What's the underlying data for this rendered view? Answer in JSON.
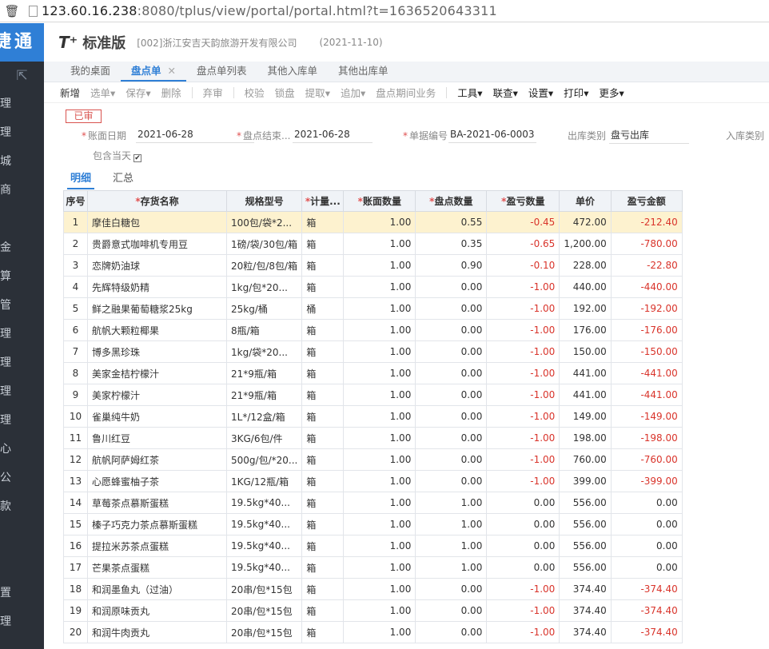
{
  "browser": {
    "url_host": "123.60.16.238",
    "url_rest": ":8080/tplus/view/portal/portal.html?t=1636520643311"
  },
  "sidebar": {
    "brand": "捷通",
    "items": [
      "理",
      "理",
      "城",
      "商",
      "金",
      "算",
      "管",
      "理",
      "理",
      "理",
      "理",
      "心",
      "公",
      "款",
      "置",
      "理"
    ]
  },
  "header": {
    "logo": "T⁺",
    "product": "标准版",
    "company": "[002]浙江安吉天韵旅游开发有限公司",
    "date": "(2021-11-10)"
  },
  "tabs": [
    {
      "label": "我的桌面",
      "active": false
    },
    {
      "label": "盘点单",
      "active": true,
      "close": "✕"
    },
    {
      "label": "盘点单列表",
      "active": false
    },
    {
      "label": "其他入库单",
      "active": false
    },
    {
      "label": "其他出库单",
      "active": false
    }
  ],
  "toolbar": {
    "new": "新增",
    "select": "选单",
    "save": "保存",
    "delete": "删除",
    "abandon": "弃审",
    "verify": "校验",
    "lock": "锁盘",
    "extract": "提取",
    "append": "追加",
    "period_business": "盘点期间业务",
    "tools": "工具",
    "link": "联查",
    "settings": "设置",
    "print": "打印",
    "more": "更多"
  },
  "form": {
    "status_stamp": "已审",
    "account_date_label": "账面日期",
    "account_date_value": "2021-06-28",
    "count_end_label": "盘点结束...",
    "count_end_value": "2021-06-28",
    "doc_no_label": "单据编号",
    "doc_no_value": "BA-2021-06-0003",
    "out_type_label": "出库类别",
    "out_type_value": "盘亏出库",
    "in_type_label": "入库类别",
    "include_today_label": "包含当天",
    "subtab_detail": "明细",
    "subtab_summary": "汇总"
  },
  "grid": {
    "headers": [
      "序号",
      "存货名称",
      "规格型号",
      "计量...",
      "账面数量",
      "盘点数量",
      "盈亏数量",
      "单价",
      "盈亏金额"
    ],
    "rows": [
      [
        "1",
        "摩佳白糖包",
        "100包/袋*2...",
        "箱",
        "1.00",
        "0.55",
        "-0.45",
        "472.00",
        "-212.40"
      ],
      [
        "2",
        "贵爵意式咖啡机专用豆",
        "1磅/袋/30包/箱",
        "箱",
        "1.00",
        "0.35",
        "-0.65",
        "1,200.00",
        "-780.00"
      ],
      [
        "3",
        "恋牌奶油球",
        "20粒/包/8包/箱",
        "箱",
        "1.00",
        "0.90",
        "-0.10",
        "228.00",
        "-22.80"
      ],
      [
        "4",
        "先辉特级奶精",
        "1kg/包*20...",
        "箱",
        "1.00",
        "0.00",
        "-1.00",
        "440.00",
        "-440.00"
      ],
      [
        "5",
        "鲜之融果葡萄糖浆25kg",
        "25kg/桶",
        "桶",
        "1.00",
        "0.00",
        "-1.00",
        "192.00",
        "-192.00"
      ],
      [
        "6",
        "航帆大颗粒椰果",
        "8瓶/箱",
        "箱",
        "1.00",
        "0.00",
        "-1.00",
        "176.00",
        "-176.00"
      ],
      [
        "7",
        "博多黑珍珠",
        "1kg/袋*20...",
        "箱",
        "1.00",
        "0.00",
        "-1.00",
        "150.00",
        "-150.00"
      ],
      [
        "8",
        "美家金桔柠檬汁",
        "21*9瓶/箱",
        "箱",
        "1.00",
        "0.00",
        "-1.00",
        "441.00",
        "-441.00"
      ],
      [
        "9",
        "美家柠檬汁",
        "21*9瓶/箱",
        "箱",
        "1.00",
        "0.00",
        "-1.00",
        "441.00",
        "-441.00"
      ],
      [
        "10",
        "雀巢纯牛奶",
        "1L*/12盒/箱",
        "箱",
        "1.00",
        "0.00",
        "-1.00",
        "149.00",
        "-149.00"
      ],
      [
        "11",
        "鲁川红豆",
        "3KG/6包/件",
        "箱",
        "1.00",
        "0.00",
        "-1.00",
        "198.00",
        "-198.00"
      ],
      [
        "12",
        "航帆阿萨姆红茶",
        "500g/包/*20...",
        "箱",
        "1.00",
        "0.00",
        "-1.00",
        "760.00",
        "-760.00"
      ],
      [
        "13",
        "心愿蜂蜜柚子茶",
        "1KG/12瓶/箱",
        "箱",
        "1.00",
        "0.00",
        "-1.00",
        "399.00",
        "-399.00"
      ],
      [
        "14",
        "草莓茶点慕斯蛋糕",
        "19.5kg*40...",
        "箱",
        "1.00",
        "1.00",
        "0.00",
        "556.00",
        "0.00"
      ],
      [
        "15",
        "榛子巧克力茶点慕斯蛋糕",
        "19.5kg*40...",
        "箱",
        "1.00",
        "1.00",
        "0.00",
        "556.00",
        "0.00"
      ],
      [
        "16",
        "提拉米苏茶点蛋糕",
        "19.5kg*40...",
        "箱",
        "1.00",
        "1.00",
        "0.00",
        "556.00",
        "0.00"
      ],
      [
        "17",
        "芒果茶点蛋糕",
        "19.5kg*40...",
        "箱",
        "1.00",
        "1.00",
        "0.00",
        "556.00",
        "0.00"
      ],
      [
        "18",
        "和润墨鱼丸（过油）",
        "20串/包*15包",
        "箱",
        "1.00",
        "0.00",
        "-1.00",
        "374.40",
        "-374.40"
      ],
      [
        "19",
        "和润原味贡丸",
        "20串/包*15包",
        "箱",
        "1.00",
        "0.00",
        "-1.00",
        "374.40",
        "-374.40"
      ],
      [
        "20",
        "和润牛肉贡丸",
        "20串/包*15包",
        "箱",
        "1.00",
        "0.00",
        "-1.00",
        "374.40",
        "-374.40"
      ]
    ]
  }
}
